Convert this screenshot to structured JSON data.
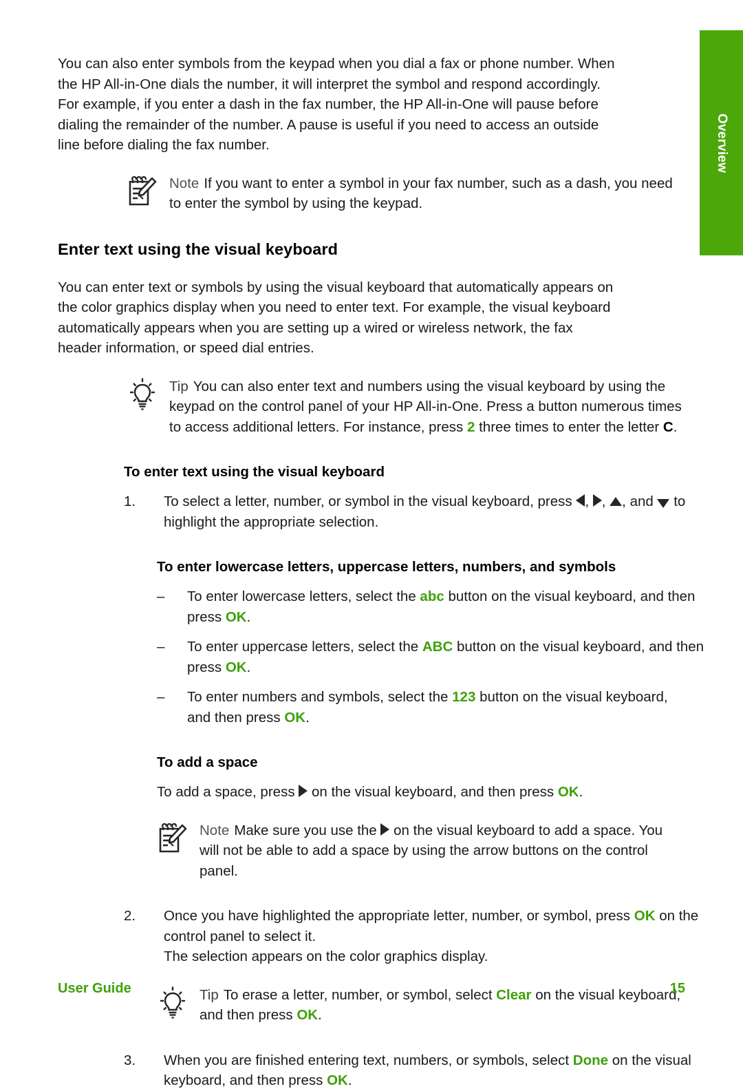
{
  "page": {
    "side_tab_label": "Overview",
    "accent_green": "#3fa00a",
    "tab_green": "#4ca70b"
  },
  "intro": {
    "paragraph": "You can also enter symbols from the keypad when you dial a fax or phone number. When the HP All-in-One dials the number, it will interpret the symbol and respond accordingly. For example, if you enter a dash in the fax number, the HP All-in-One will pause before dialing the remainder of the number. A pause is useful if you need to access an outside line before dialing the fax number."
  },
  "note1": {
    "icon": "note-pad-pencil-icon",
    "label": "Note",
    "text": "If you want to enter a symbol in your fax number, such as a dash, you need to enter the symbol by using the keypad."
  },
  "heading": {
    "title": "Enter text using the visual keyboard"
  },
  "section_intro": {
    "paragraph": "You can enter text or symbols by using the visual keyboard that automatically appears on the color graphics display when you need to enter text. For example, the visual keyboard automatically appears when you are setting up a wired or wireless network, the fax header information, or speed dial entries."
  },
  "tip1": {
    "icon": "lightbulb-icon",
    "label": "Tip",
    "text_part1": "You can also enter text and numbers using the visual keyboard by using the keypad on the control panel of your HP All-in-One. Press a button numerous times to access additional letters. For instance, press",
    "key": "2",
    "text_part2": "three times to enter the letter",
    "letter": "C",
    "text_part3": "."
  },
  "procedure": {
    "heading": "To enter text using the visual keyboard",
    "step1": {
      "number": "1.",
      "text_part1": "To select a letter, number, or symbol in the visual keyboard, press",
      "arrow_left": "left-triangle",
      "sep1": ",",
      "arrow_right": "right-triangle",
      "sep2": ",",
      "arrow_up": "up-triangle",
      "text_part2": ", and",
      "arrow_down": "down-triangle",
      "text_part3": "to highlight the appropriate selection."
    },
    "step2": {
      "number": "2.",
      "text_part1": "Once you have highlighted the appropriate letter, number, or symbol, press",
      "key_ok": "OK",
      "text_part2": "on the control panel to select it.",
      "result": "The selection appears on the color graphics display."
    },
    "step3": {
      "number": "3.",
      "text_part1": "When you are finished entering text, numbers, or symbols, select",
      "key_done": "Done",
      "text_part2": "on the visual keyboard, and then press",
      "key_ok": "OK",
      "text_part3": "."
    }
  },
  "case_section": {
    "heading": "To enter lowercase letters, uppercase letters, numbers, and symbols",
    "items": [
      {
        "dash": "–",
        "text_part1": "To enter lowercase letters, select the",
        "key": "abc",
        "text_part2": "button on the visual keyboard, and then press",
        "key_ok": "OK",
        "text_part3": "."
      },
      {
        "dash": "–",
        "text_part1": "To enter uppercase letters, select the",
        "key": "ABC",
        "text_part2": "button on the visual keyboard, and then press",
        "key_ok": "OK",
        "text_part3": "."
      },
      {
        "dash": "–",
        "text_part1": "To enter numbers and symbols, select the",
        "key": "123",
        "text_part2": "button on the visual keyboard, and then press",
        "key_ok": "OK",
        "text_part3": "."
      }
    ]
  },
  "space_section": {
    "heading": "To add a space",
    "text_part1": "To add a space, press",
    "arrow": "right-triangle",
    "text_part2": "on the visual keyboard, and then press",
    "key_ok": "OK",
    "text_part3": "."
  },
  "note2": {
    "icon": "note-pad-pencil-icon",
    "label": "Note",
    "text_part1": "Make sure you use the",
    "arrow": "right-triangle",
    "text_part2": "on the visual keyboard to add a space. You will not be able to add a space by using the arrow buttons on the control panel."
  },
  "tip2": {
    "icon": "lightbulb-icon",
    "label": "Tip",
    "text_part1": "To erase a letter, number, or symbol, select",
    "key_clear": "Clear",
    "text_part2": "on the visual keyboard, and then press",
    "key_ok": "OK",
    "text_part3": "."
  },
  "footer": {
    "left": "User Guide",
    "page_number": "15"
  }
}
